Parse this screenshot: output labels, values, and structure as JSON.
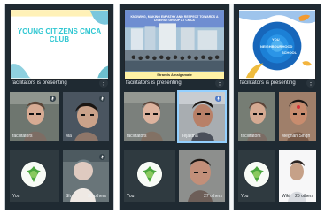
{
  "panels": {
    "left": {
      "slide_header": "POLICE PUBLIC SCHOOL CLASS 7",
      "slide_title": "YOUNG CITIZENS CMCA CLUB",
      "presenting_label": "facilitators is presenting",
      "tiles": [
        {
          "label": "facilitators"
        },
        {
          "label": "Ma"
        },
        {
          "label": "You"
        },
        {
          "label": "Sh",
          "count": "30 others"
        }
      ]
    },
    "middle": {
      "banner_text": "KNOWING, MAKING EMPATHY AND RESPECT TOWARDS A DIVERSE GROUP AT CMCA",
      "banner_footer": "Strands Amalgamate",
      "presenting_label": "facilitators is presenting",
      "tiles": [
        {
          "label": "facilitators"
        },
        {
          "label": "Tejastha"
        },
        {
          "label": "You"
        },
        {
          "label": "",
          "count": "27 others"
        }
      ]
    },
    "right": {
      "slide_words": [
        "YOU",
        "NEIGHBOURHOOD",
        "SCHOOL"
      ],
      "presenting_label": "facilitators is presenting",
      "tiles": [
        {
          "label": "facilitators"
        },
        {
          "label": "Meghan Singh"
        },
        {
          "label": "You"
        },
        {
          "label": "Wiki",
          "count": "25 others"
        }
      ]
    }
  },
  "colors": {
    "accent_blue": "#94d0ff",
    "cmca_green": "#4aa63d",
    "teal_text": "#30c7d2",
    "meet_bg": "#1f2a32"
  },
  "icons": {
    "mic": "mic-off-icon",
    "more": "more-vert-icon",
    "logo": "cmca-logo-icon"
  }
}
